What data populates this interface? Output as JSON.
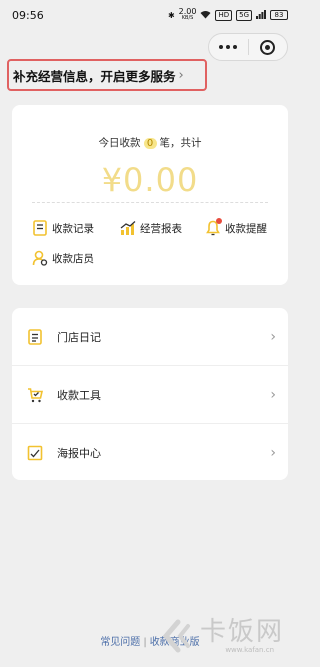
{
  "statusbar": {
    "time": "09:56",
    "network_speed": "2.00",
    "network_unit": "KB/S",
    "hd": "HD",
    "signal": "5G",
    "battery": "83"
  },
  "capsule": {
    "more_icon": "more-dots-icon",
    "close_icon": "target-circle-icon"
  },
  "banner": {
    "text": "补充经营信息，开启更多服务",
    "chevron": "›"
  },
  "summary": {
    "prefix": "今日收款",
    "count": "0",
    "suffix": "笔，共计",
    "amount": "¥0.00"
  },
  "quick_actions": [
    {
      "label": "收款记录",
      "icon": "receipt-icon"
    },
    {
      "label": "经营报表",
      "icon": "bar-chart-icon"
    },
    {
      "label": "收款提醒",
      "icon": "bell-icon"
    },
    {
      "label": "收款店员",
      "icon": "clerk-icon"
    }
  ],
  "menu": [
    {
      "label": "门店日记",
      "icon": "notebook-icon",
      "arrow": "›"
    },
    {
      "label": "收款工具",
      "icon": "cart-icon",
      "arrow": "›"
    },
    {
      "label": "海报中心",
      "icon": "poster-icon",
      "arrow": "›"
    }
  ],
  "footer": {
    "faq": "常见问题",
    "separator": "|",
    "pro": "收款商业版"
  },
  "watermark": {
    "brand": "卡饭网",
    "url": "www.kafan.cn"
  },
  "colors": {
    "accent": "#f2c230",
    "amount": "#f2dc8a",
    "banner_border": "#e06161",
    "link": "#4b6ea8"
  }
}
